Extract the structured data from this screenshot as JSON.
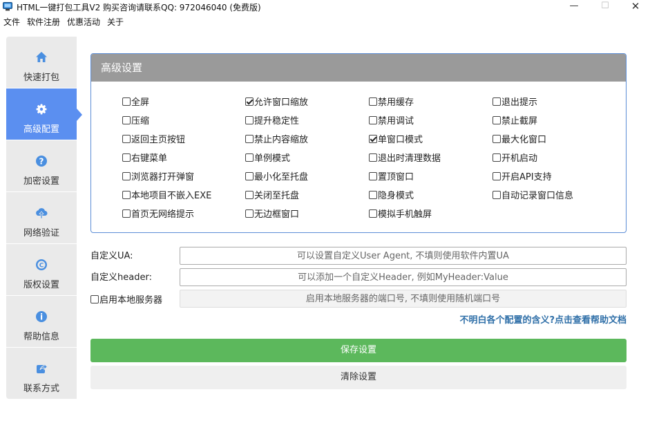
{
  "window": {
    "title": "HTML一键打包工具V2 购买咨询请联系QQ: 972046040 (免费版)",
    "minimize": "—",
    "maximize": "☐",
    "close": "✕"
  },
  "menu": [
    "文件",
    "软件注册",
    "优惠活动",
    "关于"
  ],
  "sidebar": {
    "items": [
      {
        "label": "快速打包",
        "icon": "home-icon",
        "active": false
      },
      {
        "label": "高级配置",
        "icon": "gear-icon",
        "active": true
      },
      {
        "label": "加密设置",
        "icon": "question-circle-icon",
        "active": false
      },
      {
        "label": "网络验证",
        "icon": "cloud-upload-icon",
        "active": false
      },
      {
        "label": "版权设置",
        "icon": "copyright-icon",
        "active": false
      },
      {
        "label": "帮助信息",
        "icon": "info-circle-icon",
        "active": false
      },
      {
        "label": "联系方式",
        "icon": "share-icon",
        "active": false
      }
    ]
  },
  "panel": {
    "title": "高级设置",
    "options": [
      [
        {
          "label": "全屏",
          "checked": false
        },
        {
          "label": "压缩",
          "checked": false
        },
        {
          "label": "返回主页按钮",
          "checked": false
        },
        {
          "label": "右键菜单",
          "checked": false
        },
        {
          "label": "浏览器打开弹窗",
          "checked": false
        },
        {
          "label": "本地项目不嵌入EXE",
          "checked": false
        },
        {
          "label": "首页无网络提示",
          "checked": false
        }
      ],
      [
        {
          "label": "允许窗口缩放",
          "checked": true
        },
        {
          "label": "提升稳定性",
          "checked": false
        },
        {
          "label": "禁止内容缩放",
          "checked": false
        },
        {
          "label": "单例模式",
          "checked": false
        },
        {
          "label": "最小化至托盘",
          "checked": false
        },
        {
          "label": "关闭至托盘",
          "checked": false
        },
        {
          "label": "无边框窗口",
          "checked": false
        }
      ],
      [
        {
          "label": "禁用缓存",
          "checked": false
        },
        {
          "label": "禁用调试",
          "checked": false
        },
        {
          "label": "单窗口模式",
          "checked": true
        },
        {
          "label": "退出时清理数据",
          "checked": false
        },
        {
          "label": "置顶窗口",
          "checked": false
        },
        {
          "label": "隐身模式",
          "checked": false
        },
        {
          "label": "模拟手机触屏",
          "checked": false
        }
      ],
      [
        {
          "label": "退出提示",
          "checked": false
        },
        {
          "label": "禁止截屏",
          "checked": false
        },
        {
          "label": "最大化窗口",
          "checked": false
        },
        {
          "label": "开机启动",
          "checked": false
        },
        {
          "label": "开启API支持",
          "checked": false
        },
        {
          "label": "自动记录窗口信息",
          "checked": false
        }
      ]
    ]
  },
  "form": {
    "ua_label": "自定义UA:",
    "ua_placeholder": "可以设置自定义User Agent, 不填则使用软件内置UA",
    "ua_value": "",
    "header_label": "自定义header:",
    "header_placeholder": "可以添加一个自定义Header, 例如MyHeader:Value",
    "header_value": "",
    "local_server_label": "启用本地服务器",
    "local_server_checked": false,
    "port_placeholder": "启用本地服务器的端口号, 不填则使用随机端口号",
    "port_value": ""
  },
  "help_link": "不明白各个配置的含义?点击查看帮助文档",
  "buttons": {
    "save": "保存设置",
    "clear": "清除设置"
  },
  "colors": {
    "accent": "#5b8ff0",
    "panel_header": "#9a9a9a",
    "save_button": "#5cb85c",
    "link": "#2f6fa8"
  }
}
